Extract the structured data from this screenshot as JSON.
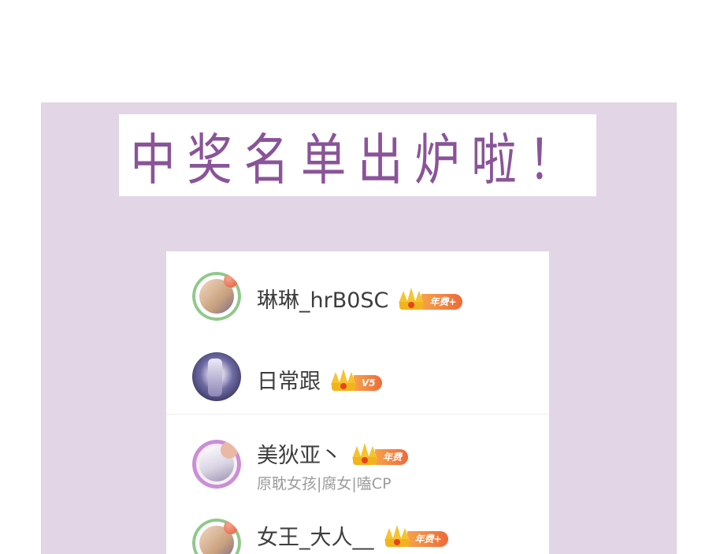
{
  "banner": {
    "title": "中奖名单出炉啦！"
  },
  "winners": [
    {
      "name": "琳琳_hrB0SC",
      "badge": "年费+",
      "subtitle": ""
    },
    {
      "name": "日常跟",
      "badge": "V5",
      "subtitle": ""
    },
    {
      "name": "美狄亚丶",
      "badge": "年费",
      "subtitle": "原耽女孩|腐女|嗑CP"
    },
    {
      "name": "女王_大人__",
      "badge": "年费+",
      "subtitle": ""
    }
  ],
  "colors": {
    "panel_bg": "#e2d5e6",
    "title_color": "#8a5499",
    "badge_orange": "#ed6a3a",
    "crown_gold": "#f6c330"
  },
  "icons": [
    "avatar",
    "crown-icon"
  ]
}
